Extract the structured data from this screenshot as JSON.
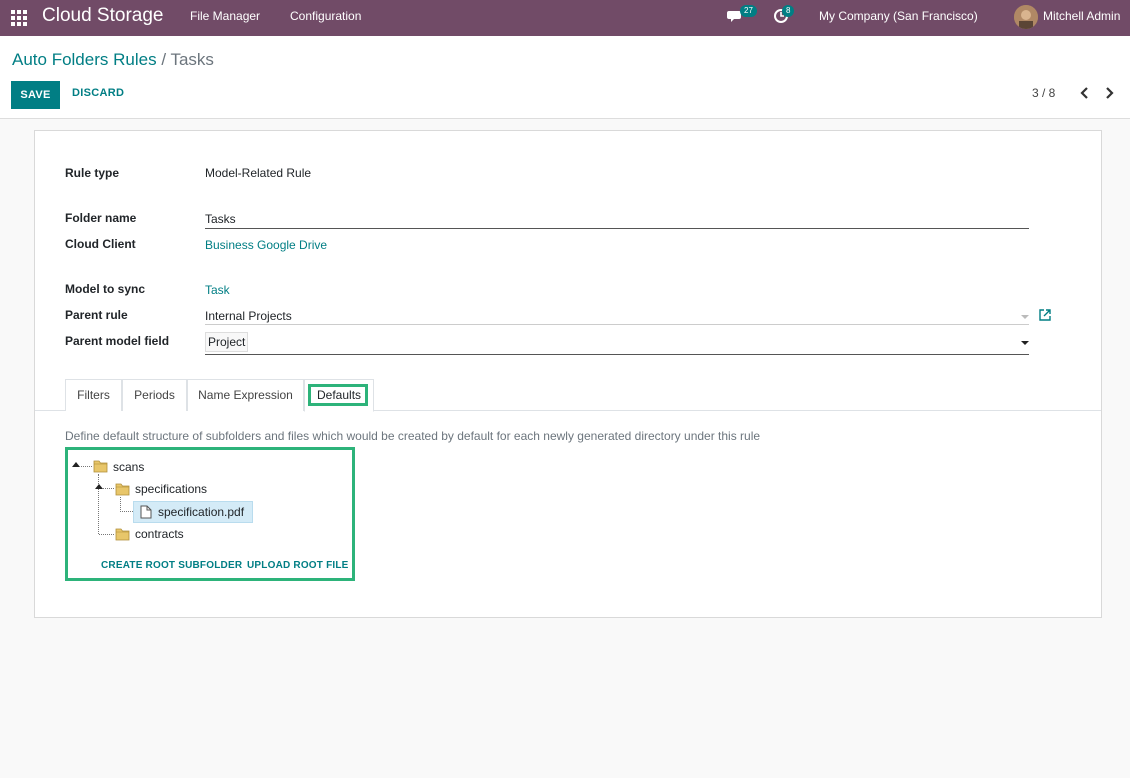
{
  "navbar": {
    "brand": "Cloud Storage",
    "menu": [
      "File Manager",
      "Configuration"
    ],
    "messages_count": "27",
    "activities_count": "8",
    "company": "My Company (San Francisco)",
    "user": "Mitchell Admin"
  },
  "breadcrumb": {
    "parent": "Auto Folders Rules",
    "separator": "/",
    "current": "Tasks"
  },
  "actions": {
    "save": "SAVE",
    "discard": "DISCARD"
  },
  "pager": {
    "value": "3 / 8"
  },
  "form": {
    "rule_type_label": "Rule type",
    "rule_type_value": "Model-Related Rule",
    "folder_name_label": "Folder name",
    "folder_name_value": "Tasks",
    "cloud_client_label": "Cloud Client",
    "cloud_client_value": "Business Google Drive",
    "model_label": "Model to sync",
    "model_value": "Task",
    "parent_rule_label": "Parent rule",
    "parent_rule_value": "Internal Projects",
    "parent_field_label": "Parent model field",
    "parent_field_value": "Project"
  },
  "tabs": [
    "Filters",
    "Periods",
    "Name Expression",
    "Defaults"
  ],
  "defaults": {
    "description": "Define default structure of subfolders and files which would be created by default for each newly generated directory under this rule",
    "tree": {
      "root": "scans",
      "child_folder": "specifications",
      "file": "specification.pdf",
      "sibling_folder": "contracts"
    },
    "create_subfolder": "CREATE ROOT SUBFOLDER",
    "upload_file": "UPLOAD ROOT FILE"
  },
  "colors": {
    "navbar": "#714b67",
    "accent": "#017e84",
    "highlight": "#2db37a"
  }
}
